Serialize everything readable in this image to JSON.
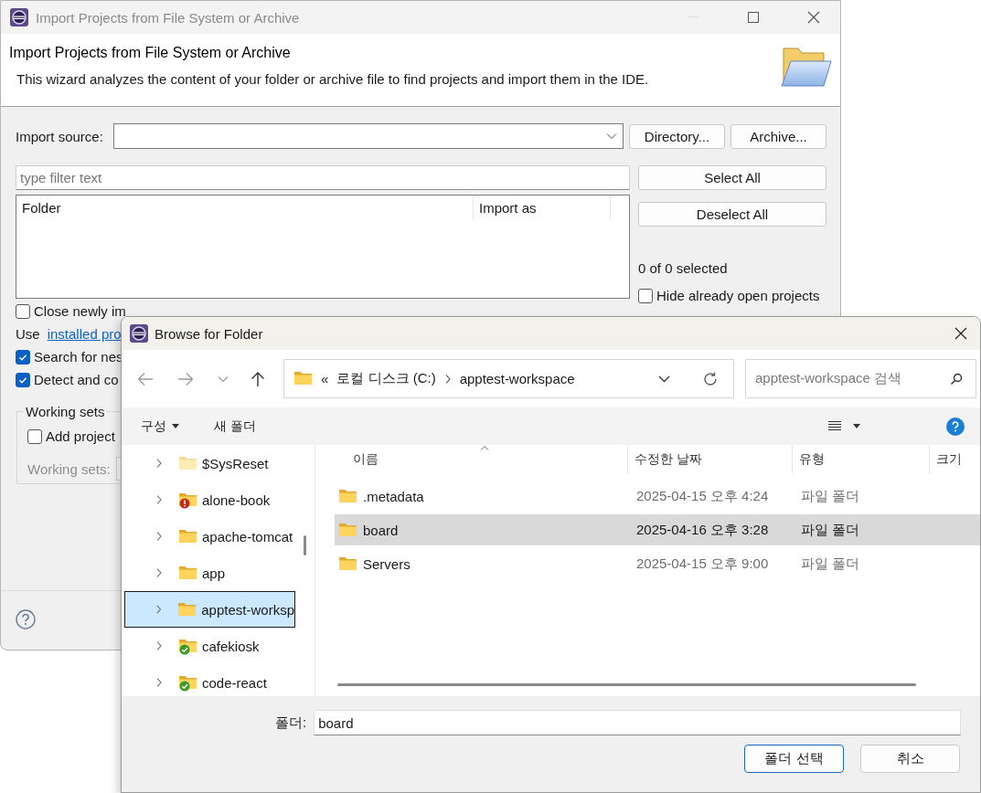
{
  "import_window": {
    "title": "Import Projects from File System or Archive",
    "header": {
      "title": "Import Projects from File System or Archive",
      "description": "This wizard analyzes the content of your folder or archive file to find projects and import them in the IDE."
    },
    "import_source": {
      "label": "Import source:"
    },
    "source_buttons": [
      "Directory...",
      "Archive..."
    ],
    "filter": {
      "placeholder": "type filter text"
    },
    "table": {
      "columns": [
        "Folder",
        "Import as"
      ]
    },
    "selection_buttons": [
      "Select All",
      "Deselect All"
    ],
    "selection_count": "0 of 0 selected",
    "hide_open": {
      "label": "Hide already open projects",
      "checked": false
    },
    "options": [
      {
        "kind": "checkbox",
        "label": "Close newly im",
        "checked": false
      },
      {
        "kind": "link",
        "text": "Use",
        "link": "installed pro"
      },
      {
        "kind": "checkbox",
        "label": "Search for nes",
        "checked": true
      },
      {
        "kind": "checkbox",
        "label": "Detect and co",
        "checked": true
      }
    ],
    "working_sets": {
      "title": "Working sets",
      "add": {
        "label": "Add project",
        "checked": false
      },
      "field_label": "Working sets:",
      "disabled": true
    }
  },
  "browse_dialog": {
    "title": "Browse for Folder",
    "address": {
      "overflow": "«",
      "segments": [
        "로컬 디스크 (C:)",
        "apptest-workspace"
      ]
    },
    "search": {
      "placeholder": "apptest-workspace 검색"
    },
    "commands": [
      {
        "label": "구성",
        "dropdown": true
      },
      {
        "label": "새 폴더",
        "dropdown": false
      }
    ],
    "tree": [
      {
        "label": "$SysReset",
        "kind": "hidden",
        "selected": false
      },
      {
        "label": "alone-book",
        "kind": "error",
        "selected": false
      },
      {
        "label": "apache-tomcat",
        "kind": "plain",
        "selected": false
      },
      {
        "label": "app",
        "kind": "plain",
        "selected": false
      },
      {
        "label": "apptest-worksp",
        "kind": "plain",
        "selected": true
      },
      {
        "label": "cafekiosk",
        "kind": "synced",
        "selected": false
      },
      {
        "label": "code-react",
        "kind": "synced",
        "selected": false
      }
    ],
    "columns": [
      "이름",
      "수정한 날짜",
      "유형",
      "크기"
    ],
    "files": [
      {
        "name": ".metadata",
        "date": "2025-04-15 오후 4:24",
        "type": "파일 폴더",
        "selected": false
      },
      {
        "name": "board",
        "date": "2025-04-16 오후 3:28",
        "type": "파일 폴더",
        "selected": true
      },
      {
        "name": "Servers",
        "date": "2025-04-15 오후 9:00",
        "type": "파일 폴더",
        "selected": false
      }
    ],
    "folder_field": {
      "label": "폴더:",
      "value": "board"
    },
    "buttons": [
      {
        "label": "폴더 선택",
        "default": true
      },
      {
        "label": "취소",
        "default": false
      }
    ]
  }
}
